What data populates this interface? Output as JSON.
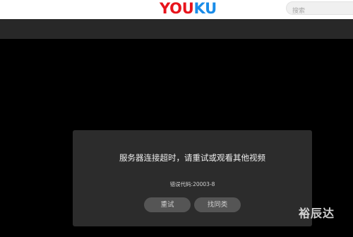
{
  "header": {
    "logo_part1": "YOU",
    "logo_part2": "KU",
    "search_placeholder": "搜索"
  },
  "error_dialog": {
    "message": "服务器连接超时，请重试或观看其他视频",
    "error_code": "错误代码:20003-8",
    "retry_label": "重试",
    "find_similar_label": "找同类"
  },
  "watermark": "裕辰达",
  "colors": {
    "logo_red": "#e8141c",
    "logo_blue": "#1a8ce8",
    "dialog_bg": "#2c2c2c",
    "button_bg": "#555555"
  }
}
